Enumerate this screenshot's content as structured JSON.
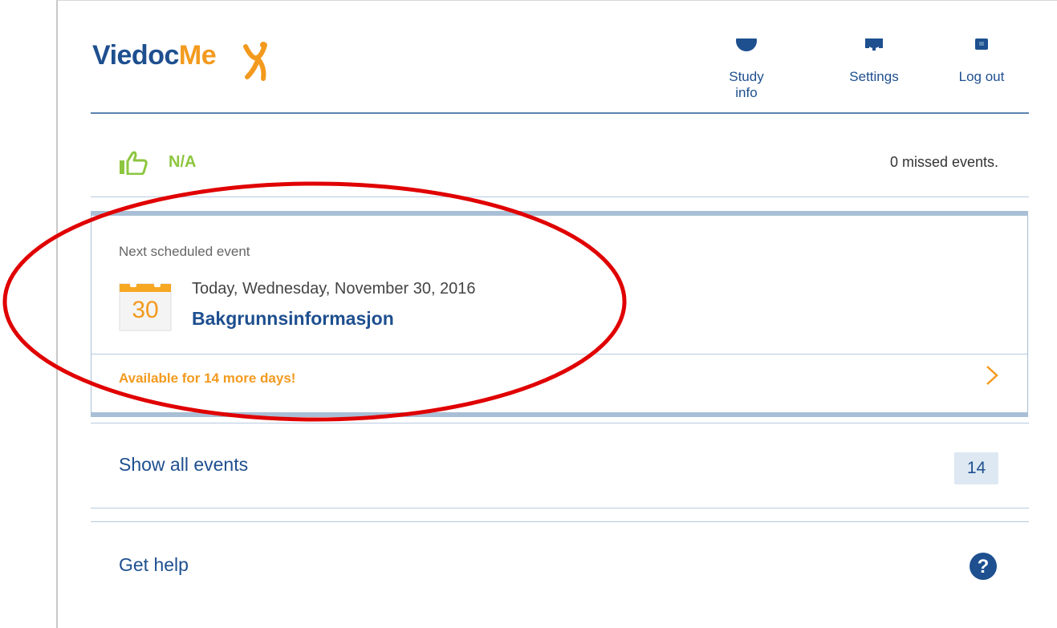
{
  "brand": {
    "part1": "Viedoc",
    "part2": "Me"
  },
  "nav": [
    {
      "label": "Study info",
      "icon": "info-icon"
    },
    {
      "label": "Settings",
      "icon": "gear-icon"
    },
    {
      "label": "Log out",
      "icon": "logout-icon"
    }
  ],
  "status": {
    "icon": "thumbs-up-icon",
    "value": "N/A",
    "missed": "0 missed events."
  },
  "next_event": {
    "heading": "Next scheduled event",
    "day": "30",
    "date": "Today, Wednesday, November 30, 2016",
    "name": "Bakgrunnsinformasjon",
    "availability": "Available for 14 more days!"
  },
  "links": {
    "show_all": "Show all events",
    "event_count": "14",
    "help": "Get help",
    "help_icon_glyph": "?"
  },
  "colors": {
    "brand_blue": "#1e4f8f",
    "accent_orange": "#f39a1e",
    "status_green": "#8dc63f",
    "annotation_red": "#e00000"
  }
}
